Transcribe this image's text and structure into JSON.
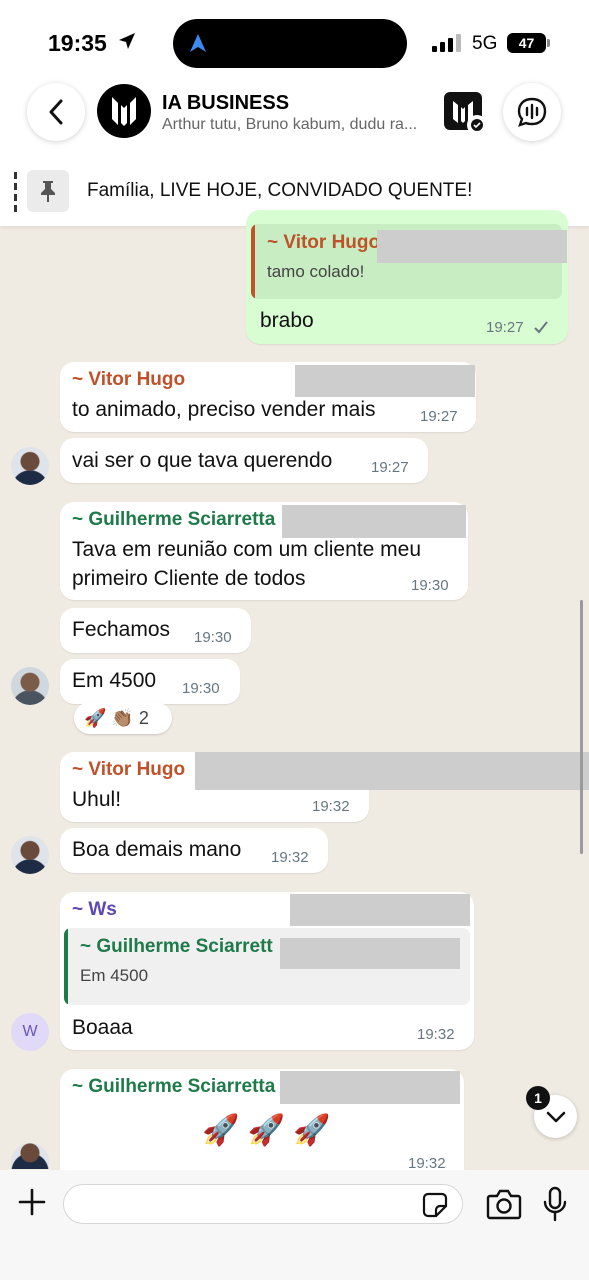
{
  "status_bar": {
    "time": "19:35",
    "network": "5G",
    "battery": "47"
  },
  "header": {
    "title": "IA BUSINESS",
    "members": "Arthur tutu, Bruno kabum, dudu ra..."
  },
  "pinned": {
    "text": "Família, LIVE HOJE, CONVIDADO QUENTE!"
  },
  "messages": [
    {
      "quote_name": "~ Vitor Hugo",
      "quote_text": "tamo colado!",
      "text": "brabo",
      "time": "19:27"
    },
    {
      "sender": "~ Vitor Hugo",
      "text": "to animado, preciso vender mais",
      "time": "19:27"
    },
    {
      "text": "vai ser o que tava querendo",
      "time": "19:27"
    },
    {
      "sender": "~ Guilherme Sciarretta",
      "text_line1": "Tava em reunião com um cliente meu",
      "text_line2": "primeiro Cliente de todos",
      "time": "19:30"
    },
    {
      "text": "Fechamos",
      "time": "19:30"
    },
    {
      "text": "Em 4500",
      "time": "19:30",
      "reactions": "🚀 👏🏽 2"
    },
    {
      "sender": "~ Vitor Hugo",
      "text": "Uhul!",
      "time": "19:32"
    },
    {
      "text": "Boa demais mano",
      "time": "19:32"
    },
    {
      "sender": "~ Ws",
      "avatar_letter": "W",
      "quote_name": "~ Guilherme Sciarrett",
      "quote_text": "Em 4500",
      "text": "Boaaa",
      "time": "19:32"
    },
    {
      "sender": "~ Guilherme Sciarretta",
      "text": "🚀 🚀 🚀",
      "time": "19:32"
    }
  ],
  "scroll_down_badge": "1",
  "colors": {
    "vitor": "#c0522b",
    "guilherme": "#1f7a4a",
    "ws": "#5b47b5",
    "outgoing_bubble": "#d9fdd3",
    "chat_bg": "#efeae2"
  }
}
